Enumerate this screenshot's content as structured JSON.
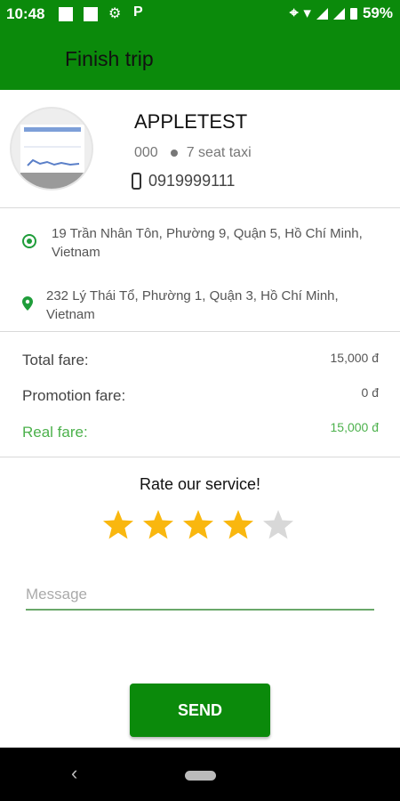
{
  "status_bar": {
    "time": "10:48",
    "battery": "59%",
    "p_icon": "P"
  },
  "app_bar": {
    "title": "Finish trip"
  },
  "driver": {
    "name": "APPLETEST",
    "plate": "000",
    "vehicle": "7 seat taxi",
    "phone": "0919999111"
  },
  "addresses": {
    "origin": "19 Trần Nhân Tôn, Phường 9, Quận 5, Hồ Chí Minh, Vietnam",
    "destination": "232 Lý Thái Tổ, Phường 1, Quận 3, Hồ Chí Minh, Vietnam"
  },
  "fares": {
    "total_label": "Total fare:",
    "total_value": "15,000 đ",
    "promotion_label": "Promotion fare:",
    "promotion_value": "0 đ",
    "real_label": "Real fare:",
    "real_value": "15,000 đ"
  },
  "rating": {
    "title": "Rate our service!",
    "score": 4,
    "max": 5
  },
  "message": {
    "placeholder": "Message",
    "value": ""
  },
  "send": {
    "label": "SEND"
  },
  "colors": {
    "brand": "#0b8a0b",
    "accent_green": "#4cb14c",
    "star_on": "#f9b70f",
    "star_off": "#d8d8d8"
  }
}
